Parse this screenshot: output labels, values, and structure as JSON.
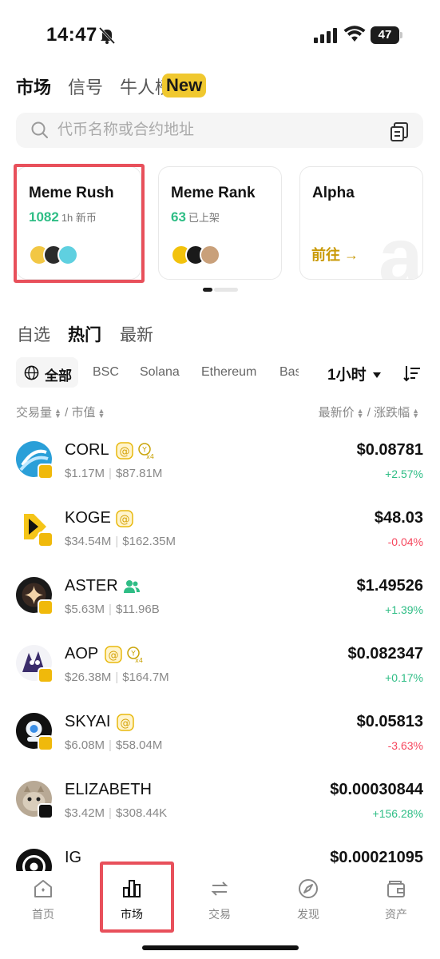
{
  "status_bar": {
    "time": "14:47",
    "battery": "47"
  },
  "top_tabs": [
    {
      "label": "市场"
    },
    {
      "label": "信号"
    },
    {
      "label": "牛人榜"
    }
  ],
  "new_badge": "New",
  "search": {
    "placeholder": "代币名称或合约地址"
  },
  "cards": {
    "meme_rush": {
      "title": "Meme Rush",
      "count": "1082",
      "count_label": "1h 新币"
    },
    "meme_rank": {
      "title": "Meme Rank",
      "count": "63",
      "count_label": "已上架"
    },
    "alpha": {
      "title": "Alpha",
      "goto": "前往 →"
    }
  },
  "section_tabs": [
    {
      "label": "自选"
    },
    {
      "label": "热门"
    },
    {
      "label": "最新"
    }
  ],
  "chains": {
    "all": "全部",
    "items": [
      "BSC",
      "Solana",
      "Ethereum",
      "Bas"
    ]
  },
  "time_filter": "1小时",
  "columns": {
    "left": "交易量 ⬍ / 市值",
    "left_a": "交易量",
    "left_b": "/ 市值",
    "right_a": "最新价",
    "right_b": "/ 涨跌幅"
  },
  "tokens": [
    {
      "symbol": "CORL",
      "volume": "$1.17M",
      "mcap": "$87.81M",
      "price": "$0.08781",
      "change": "+2.57%",
      "dir": "up"
    },
    {
      "symbol": "KOGE",
      "volume": "$34.54M",
      "mcap": "$162.35M",
      "price": "$48.03",
      "change": "-0.04%",
      "dir": "down"
    },
    {
      "symbol": "ASTER",
      "volume": "$5.63M",
      "mcap": "$11.96B",
      "price": "$1.49526",
      "change": "+1.39%",
      "dir": "up"
    },
    {
      "symbol": "AOP",
      "volume": "$26.38M",
      "mcap": "$164.7M",
      "price": "$0.082347",
      "change": "+0.17%",
      "dir": "up"
    },
    {
      "symbol": "SKYAI",
      "volume": "$6.08M",
      "mcap": "$58.04M",
      "price": "$0.05813",
      "change": "-3.63%",
      "dir": "down"
    },
    {
      "symbol": "ELIZABETH",
      "volume": "$3.42M",
      "mcap": "$308.44K",
      "price": "$0.00030844",
      "change": "+156.28%",
      "dir": "up"
    },
    {
      "symbol": "IG",
      "volume": "",
      "mcap": "",
      "price": "$0.00021095",
      "change": "",
      "dir": "up"
    }
  ],
  "bottom_nav": [
    {
      "label": "首页"
    },
    {
      "label": "市场"
    },
    {
      "label": "交易"
    },
    {
      "label": "发现"
    },
    {
      "label": "资产"
    }
  ],
  "colors": {
    "up": "#2ebd85",
    "down": "#f6465d",
    "accent": "#f0b90b",
    "highlight": "#e8505b"
  }
}
